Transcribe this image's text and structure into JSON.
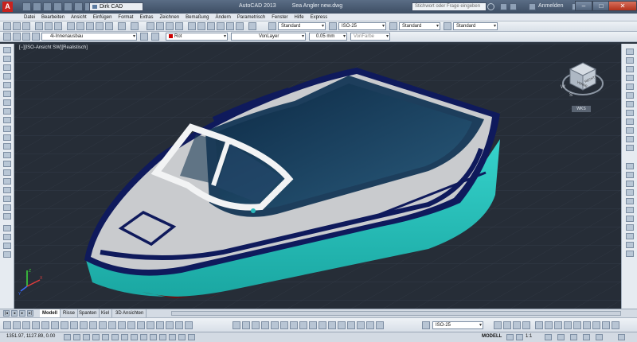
{
  "titlebar": {
    "workspace": "Dirk CAD",
    "app_name": "AutoCAD 2013",
    "document": "Sea Angler new.dwg",
    "search_placeholder": "Stichwort oder Frage eingeben",
    "login_label": "Anmelden",
    "logo_letter": "A"
  },
  "menu": [
    "Datei",
    "Bearbeiten",
    "Ansicht",
    "Einfügen",
    "Format",
    "Extras",
    "Zeichnen",
    "Bemaßung",
    "Ändern",
    "Parametrisch",
    "Fenster",
    "Hilfe",
    "Express"
  ],
  "toolbar1": {
    "textstyle": "Standard",
    "dimstyle": "ISO-25",
    "tablestyle": "Standard",
    "mleaderstyle": "Standard"
  },
  "toolbar2": {
    "layer": "4i-Innenausbau",
    "color": "Rot",
    "linetype": "VonLayer",
    "lineweight": "0.05 mm",
    "plotstyle": "VonFarbe"
  },
  "viewport": {
    "label": "[−][ISO-Ansicht SW][Realistisch]",
    "wks_label": "WKS",
    "viewcube_face": "VORNE",
    "viewcube_face2": "RECHTS",
    "compass_w": "W",
    "compass_s": "S",
    "ucs_x": "X",
    "ucs_y": "Y",
    "ucs_z": "Z"
  },
  "tabs": [
    "Modell",
    "Risse",
    "Spanten",
    "Kiel",
    "3D Ansichten"
  ],
  "bottom_toolbar": {
    "dimstyle": "ISO-25"
  },
  "status": {
    "coords": "1351.97, 1127.89, 0.00",
    "space": "MODELL",
    "scale": "1:1"
  },
  "colors": {
    "hull_turquoise": "#2fc7c0",
    "deck_gray": "#c8cacd",
    "navy_trim": "#0f1a5c",
    "viewport_bg": "#262d37",
    "grid_line": "#38414d"
  }
}
